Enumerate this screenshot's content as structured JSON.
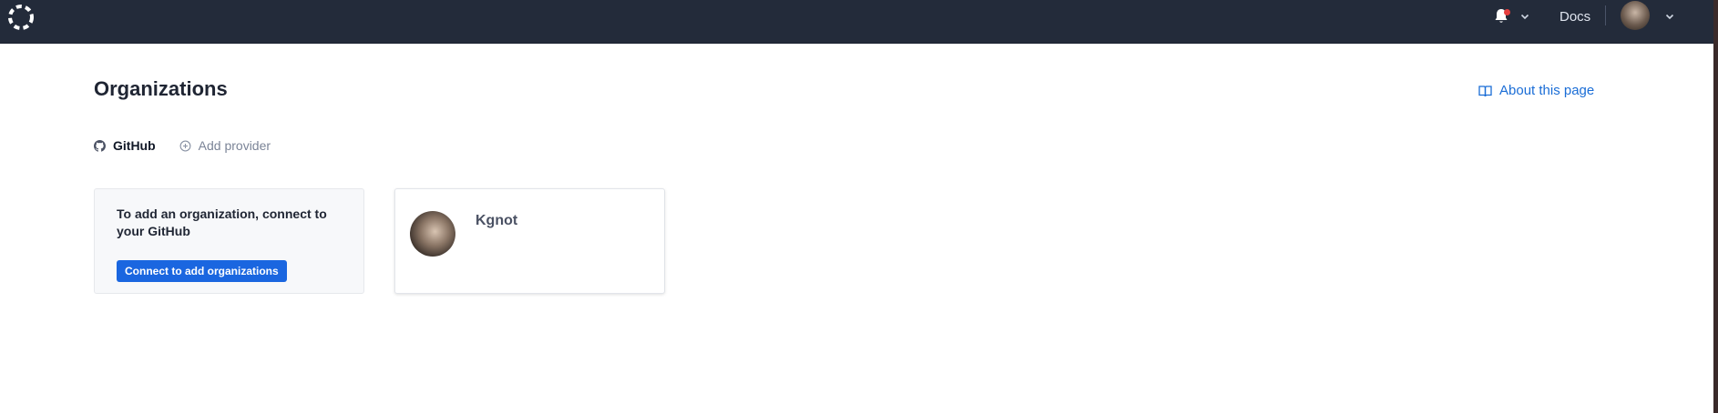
{
  "topbar": {
    "logo_icon": "dashed-circle-logo-icon",
    "notifications_icon": "bell-icon",
    "docs_label": "Docs",
    "user_avatar": "user-avatar"
  },
  "page": {
    "title": "Organizations",
    "about_label": "About this page",
    "about_icon": "book-icon"
  },
  "tabs": [
    {
      "label": "GitHub",
      "icon": "github-icon",
      "active": true
    },
    {
      "label": "Add provider",
      "icon": "plus-circle-icon",
      "active": false
    }
  ],
  "info_card": {
    "message": "To add an organization, connect to your GitHub",
    "button_label": "Connect to add organizations"
  },
  "organizations": [
    {
      "name": "Kgnot"
    }
  ],
  "colors": {
    "topbar_bg": "#232b3a",
    "accent": "#1a66e0",
    "link": "#1a6dd6",
    "notification_dot": "#e53e3e"
  }
}
